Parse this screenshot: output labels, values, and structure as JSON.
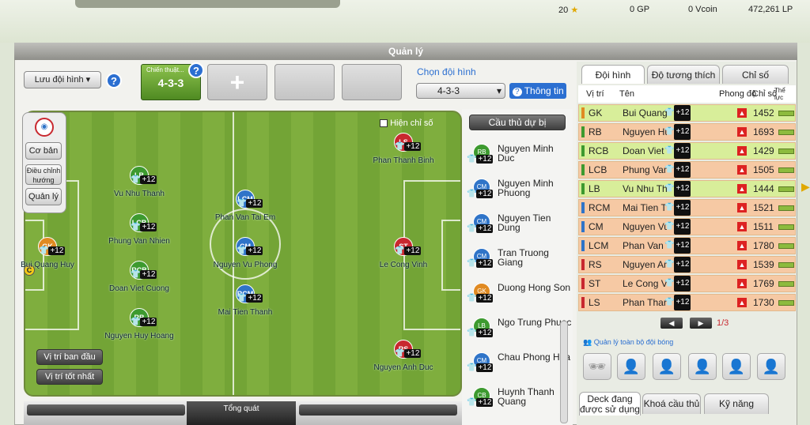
{
  "currency": {
    "stars": "20",
    "gp": "0 GP",
    "vcoin": "0 Vcoin",
    "lp": "472,261 LP"
  },
  "window": {
    "title": "Quản lý"
  },
  "toolbar": {
    "save": "Lưu đội hình",
    "tactic_label": "Chiến thuật...",
    "tactic_value": "4-3-3",
    "choose_label": "Chọn đội hình",
    "formation": "4-3-3",
    "info": "Thông tin"
  },
  "field": {
    "show_stats": "Hiện chỉ số",
    "menu": [
      "Cơ bản",
      "Điều chỉnh hướng",
      "Quản lý"
    ],
    "btn_orig": "Vị trí ban đầu",
    "btn_best": "Vị trí tốt nhất",
    "summary": "Tổng quát",
    "captain": "C",
    "players": [
      {
        "pos": "GK",
        "name": "Bui Quang Huy",
        "cls": "gk"
      },
      {
        "pos": "LB",
        "name": "Vu Nhu Thanh",
        "cls": "lb"
      },
      {
        "pos": "LCB",
        "name": "Phung Van Nhien",
        "cls": "lb"
      },
      {
        "pos": "RCB",
        "name": "Doan Viet Cuong",
        "cls": "lb"
      },
      {
        "pos": "RB",
        "name": "Nguyen Huy Hoang",
        "cls": "lb"
      },
      {
        "pos": "LCM",
        "name": "Phan Van Tai Em",
        "cls": "cm"
      },
      {
        "pos": "CM",
        "name": "Nguyen Vu Phong",
        "cls": "cm"
      },
      {
        "pos": "RCM",
        "name": "Mai Tien Thanh",
        "cls": "cm"
      },
      {
        "pos": "LS",
        "name": "Phan Thanh Binh",
        "cls": "st"
      },
      {
        "pos": "ST",
        "name": "Le Cong Vinh",
        "cls": "st"
      },
      {
        "pos": "RS",
        "name": "Nguyen Anh Duc",
        "cls": "st"
      }
    ],
    "boost": "+12"
  },
  "bench": {
    "title": "Cầu thủ dự bị",
    "players": [
      {
        "pos": "RB",
        "name": "Nguyen Minh Duc",
        "cls": "lb"
      },
      {
        "pos": "CM",
        "name": "Nguyen Minh Phuong",
        "cls": "cm"
      },
      {
        "pos": "CM",
        "name": "Nguyen Tien Dung",
        "cls": "cm"
      },
      {
        "pos": "CM",
        "name": "Tran Truong Giang",
        "cls": "cm"
      },
      {
        "pos": "GK",
        "name": "Duong Hong Son",
        "cls": "gk"
      },
      {
        "pos": "LB",
        "name": "Ngo Trung Phuoc",
        "cls": "lb"
      },
      {
        "pos": "CM",
        "name": "Chau Phong Hoa",
        "cls": "cm"
      },
      {
        "pos": "CB",
        "name": "Huynh Thanh Quang",
        "cls": "lb"
      }
    ]
  },
  "right": {
    "tabs": [
      "Đội hình",
      "Độ tương thích",
      "Chỉ số"
    ],
    "headers": [
      "Vị trí",
      "Tên",
      "Phong độ",
      "Chỉ số",
      "Thể lực"
    ],
    "rows": [
      {
        "pos": "GK",
        "name": "Bui Quang",
        "score": "1452",
        "side": "#e08a22",
        "bg": "#d8ee9a"
      },
      {
        "pos": "RB",
        "name": "Nguyen Hu",
        "score": "1693",
        "side": "#3d9a2f",
        "bg": "#f6c9a4"
      },
      {
        "pos": "RCB",
        "name": "Doan Viet",
        "score": "1429",
        "side": "#3d9a2f",
        "bg": "#d8ee9a"
      },
      {
        "pos": "LCB",
        "name": "Phung Van",
        "score": "1505",
        "side": "#3d9a2f",
        "bg": "#f6c9a4"
      },
      {
        "pos": "LB",
        "name": "Vu Nhu Th",
        "score": "1444",
        "side": "#3d9a2f",
        "bg": "#d8ee9a"
      },
      {
        "pos": "RCM",
        "name": "Mai Tien T",
        "score": "1521",
        "side": "#2f74c8",
        "bg": "#f6c9a4"
      },
      {
        "pos": "CM",
        "name": "Nguyen Vu",
        "score": "1511",
        "side": "#2f74c8",
        "bg": "#f6c9a4"
      },
      {
        "pos": "LCM",
        "name": "Phan Van",
        "score": "1780",
        "side": "#2f74c8",
        "bg": "#f6c9a4"
      },
      {
        "pos": "RS",
        "name": "Nguyen An",
        "score": "1539",
        "side": "#c8282f",
        "bg": "#f6c9a4"
      },
      {
        "pos": "ST",
        "name": "Le Cong V",
        "score": "1769",
        "side": "#c8282f",
        "bg": "#f6c9a4"
      },
      {
        "pos": "LS",
        "name": "Phan Thar",
        "score": "1730",
        "side": "#c8282f",
        "bg": "#f6c9a4"
      }
    ],
    "page": "1/3",
    "manage": "Quản lý toàn bộ đội bóng",
    "bottom_tabs": [
      "Deck đang được sử dụng",
      "Khoá cầu thủ",
      "Kỹ năng"
    ]
  }
}
